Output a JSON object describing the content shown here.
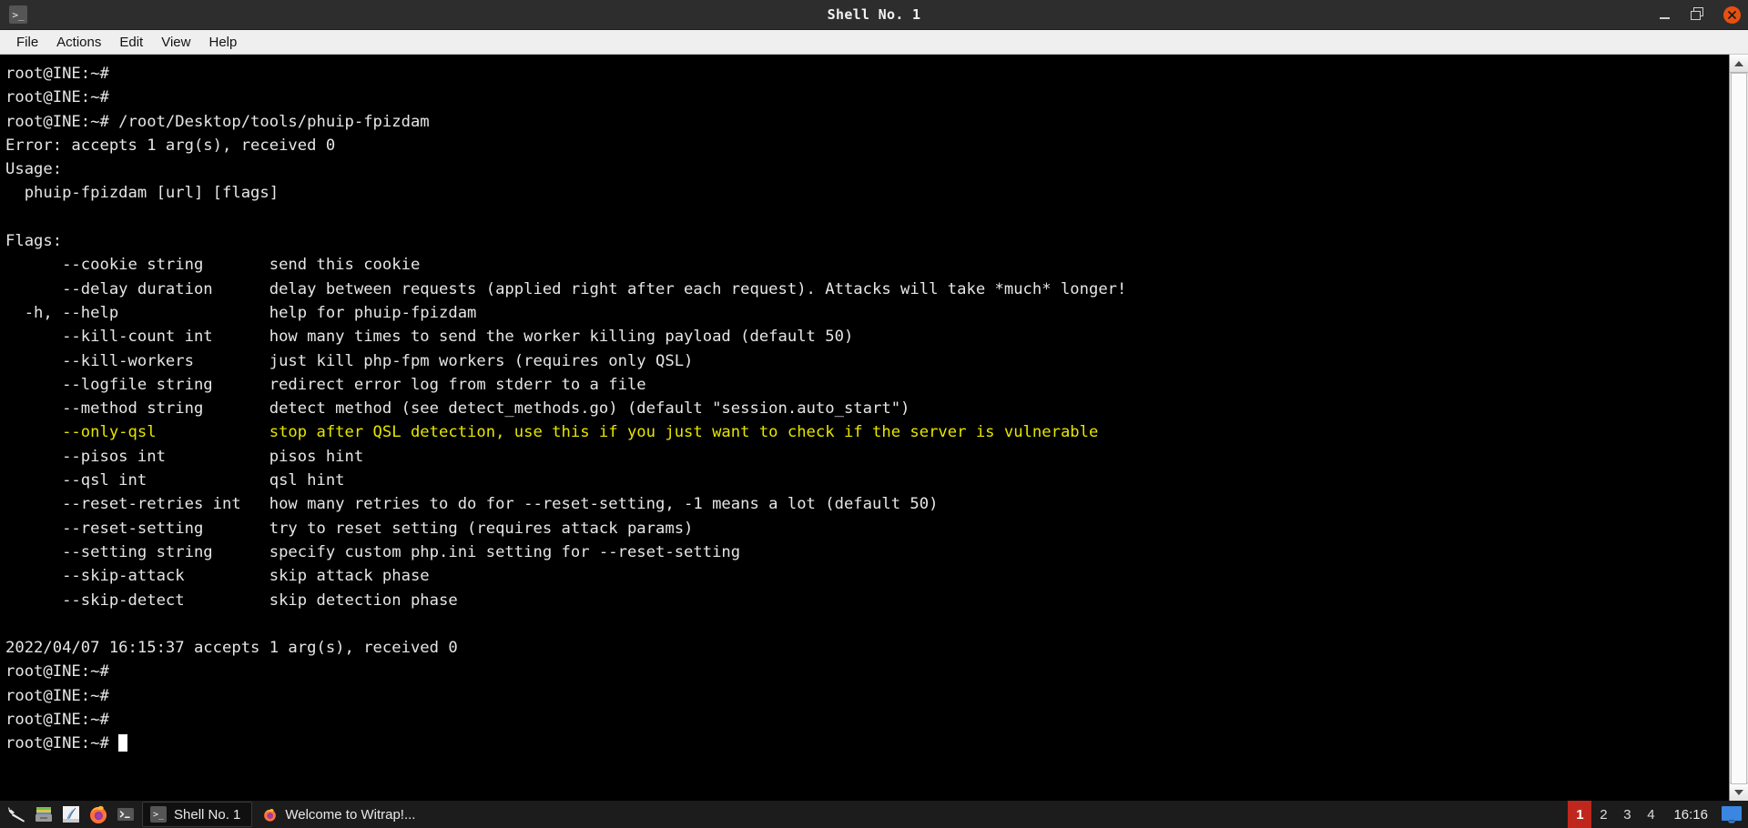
{
  "window": {
    "title": "Shell No. 1",
    "icon": "terminal-icon",
    "prompt_glyph": ">_",
    "controls": {
      "minimize": "minimize-button",
      "maximize": "maximize-button",
      "close": "close-button"
    }
  },
  "menubar": {
    "items": [
      {
        "label": "File"
      },
      {
        "label": "Actions"
      },
      {
        "label": "Edit"
      },
      {
        "label": "View"
      },
      {
        "label": "Help"
      }
    ]
  },
  "terminal": {
    "colors": {
      "background": "#000000",
      "foreground": "#e6e6e6",
      "highlight_yellow": "#e6e600",
      "cursor": "#ffffff"
    },
    "lines": [
      {
        "text": "root@INE:~#",
        "color": "default"
      },
      {
        "text": "root@INE:~#",
        "color": "default"
      },
      {
        "text": "root@INE:~# /root/Desktop/tools/phuip-fpizdam",
        "color": "default"
      },
      {
        "text": "Error: accepts 1 arg(s), received 0",
        "color": "default"
      },
      {
        "text": "Usage:",
        "color": "default"
      },
      {
        "text": "  phuip-fpizdam [url] [flags]",
        "color": "default"
      },
      {
        "text": "",
        "color": "default"
      },
      {
        "text": "Flags:",
        "color": "default"
      },
      {
        "text": "      --cookie string       send this cookie",
        "color": "default"
      },
      {
        "text": "      --delay duration      delay between requests (applied right after each request). Attacks will take *much* longer!",
        "color": "default"
      },
      {
        "text": "  -h, --help                help for phuip-fpizdam",
        "color": "default"
      },
      {
        "text": "      --kill-count int      how many times to send the worker killing payload (default 50)",
        "color": "default"
      },
      {
        "text": "      --kill-workers        just kill php-fpm workers (requires only QSL)",
        "color": "default"
      },
      {
        "text": "      --logfile string      redirect error log from stderr to a file",
        "color": "default"
      },
      {
        "text": "      --method string       detect method (see detect_methods.go) (default \"session.auto_start\")",
        "color": "default"
      },
      {
        "text": "      --only-qsl            stop after QSL detection, use this if you just want to check if the server is vulnerable",
        "color": "yellow"
      },
      {
        "text": "      --pisos int           pisos hint",
        "color": "default"
      },
      {
        "text": "      --qsl int             qsl hint",
        "color": "default"
      },
      {
        "text": "      --reset-retries int   how many retries to do for --reset-setting, -1 means a lot (default 50)",
        "color": "default"
      },
      {
        "text": "      --reset-setting       try to reset setting (requires attack params)",
        "color": "default"
      },
      {
        "text": "      --setting string      specify custom php.ini setting for --reset-setting",
        "color": "default"
      },
      {
        "text": "      --skip-attack         skip attack phase",
        "color": "default"
      },
      {
        "text": "      --skip-detect         skip detection phase",
        "color": "default"
      },
      {
        "text": "",
        "color": "default"
      },
      {
        "text": "2022/04/07 16:15:37 accepts 1 arg(s), received 0",
        "color": "default"
      },
      {
        "text": "root@INE:~#",
        "color": "default"
      },
      {
        "text": "root@INE:~#",
        "color": "default"
      },
      {
        "text": "root@INE:~#",
        "color": "default"
      },
      {
        "text": "root@INE:~# ",
        "color": "default",
        "cursor": true
      }
    ]
  },
  "scrollbar": {
    "up_arrow": "scroll-up-arrow",
    "down_arrow": "scroll-down-arrow"
  },
  "taskbar": {
    "launchers": [
      {
        "name": "kali-menu-icon",
        "label": "Kali Menu"
      },
      {
        "name": "file-manager-icon",
        "label": "File Manager"
      },
      {
        "name": "text-editor-icon",
        "label": "Text Editor"
      },
      {
        "name": "firefox-icon",
        "label": "Firefox"
      },
      {
        "name": "terminal-icon",
        "label": "Terminal"
      }
    ],
    "tasks": [
      {
        "label": "Shell No. 1",
        "icon": "terminal-icon",
        "active": true
      },
      {
        "label": "Welcome to Witrap!...",
        "icon": "firefox-icon",
        "active": false
      }
    ],
    "workspaces": [
      {
        "label": "1",
        "active": true
      },
      {
        "label": "2",
        "active": false
      },
      {
        "label": "3",
        "active": false
      },
      {
        "label": "4",
        "active": false
      }
    ],
    "clock": "16:16",
    "show_desktop": "show-desktop-icon",
    "colors": {
      "background": "#1c1c1c",
      "active_workspace": "#c0271c",
      "show_desktop": "#3a86e0"
    }
  }
}
